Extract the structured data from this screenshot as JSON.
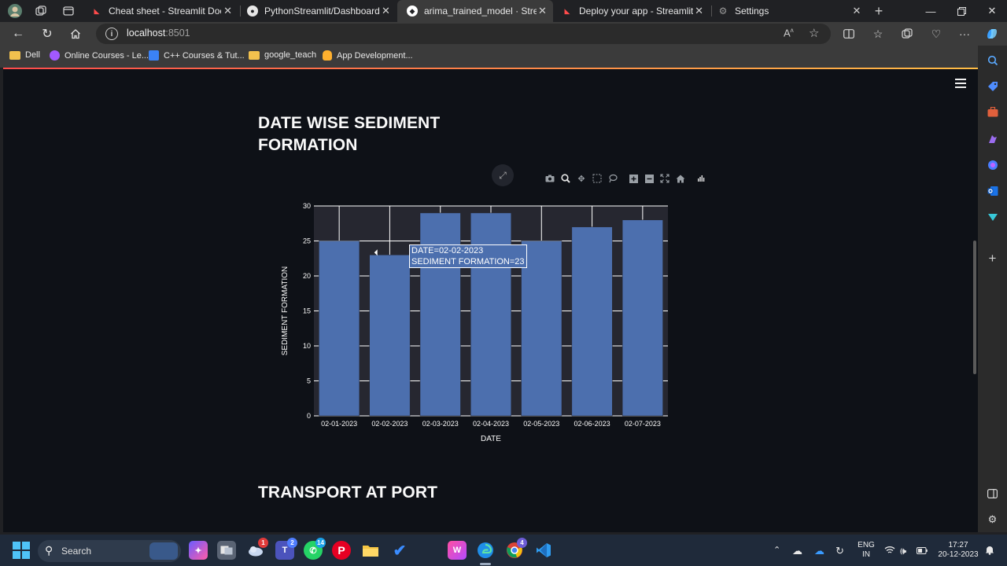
{
  "browser": {
    "tabs": [
      {
        "label": "Cheat sheet - Streamlit Docs",
        "favicon_color": "#ff4b4b",
        "active": false
      },
      {
        "label": "PythonStreamlit/Dashboard.py at",
        "favicon_color": "#e6e6e6",
        "active": false
      },
      {
        "label": "arima_trained_model · Streamlit",
        "favicon_color": "#ffffff",
        "active": true
      },
      {
        "label": "Deploy your app - Streamlit Docs",
        "favicon_color": "#ff4b4b",
        "active": false
      },
      {
        "label": "Settings",
        "favicon_color": "#888888",
        "active": false
      }
    ],
    "url_host": "localhost",
    "url_port": ":8501",
    "bookmarks": [
      {
        "label": "Dell",
        "color": "#f2c14e"
      },
      {
        "label": "Online Courses - Le...",
        "color": "#a259ff"
      },
      {
        "label": "C++ Courses & Tut...",
        "color": "#3b82f6"
      },
      {
        "label": "google_teach",
        "color": "#f2c14e"
      },
      {
        "label": "App Development...",
        "color": "#ffb02e"
      }
    ]
  },
  "page": {
    "section_title_line1": "DATE WISE SEDIMENT",
    "section_title_line2": "FORMATION",
    "next_section_title": "TRANSPORT AT PORT"
  },
  "chart_data": {
    "type": "bar",
    "categories": [
      "02-01-2023",
      "02-02-2023",
      "02-03-2023",
      "02-04-2023",
      "02-05-2023",
      "02-06-2023",
      "02-07-2023"
    ],
    "values": [
      25,
      23,
      29,
      29,
      25,
      27,
      28
    ],
    "xlabel": "DATE",
    "ylabel": "SEDIMENT FORMATION",
    "ylim": [
      0,
      30
    ],
    "yticks": [
      0,
      5,
      10,
      15,
      20,
      25,
      30
    ],
    "bar_color": "#4c6fae",
    "plot_bg": "#262730",
    "grid": true,
    "tooltip": {
      "line1": "DATE=02-02-2023",
      "line2": "SEDIMENT FORMATION=23"
    }
  },
  "taskbar": {
    "search_label": "Search",
    "lang_line1": "ENG",
    "lang_line2": "IN",
    "time": "17:27",
    "date": "20-12-2023",
    "badges": {
      "weather": "1",
      "teams": "2",
      "whatsapp": "14",
      "chrome": "4"
    }
  }
}
